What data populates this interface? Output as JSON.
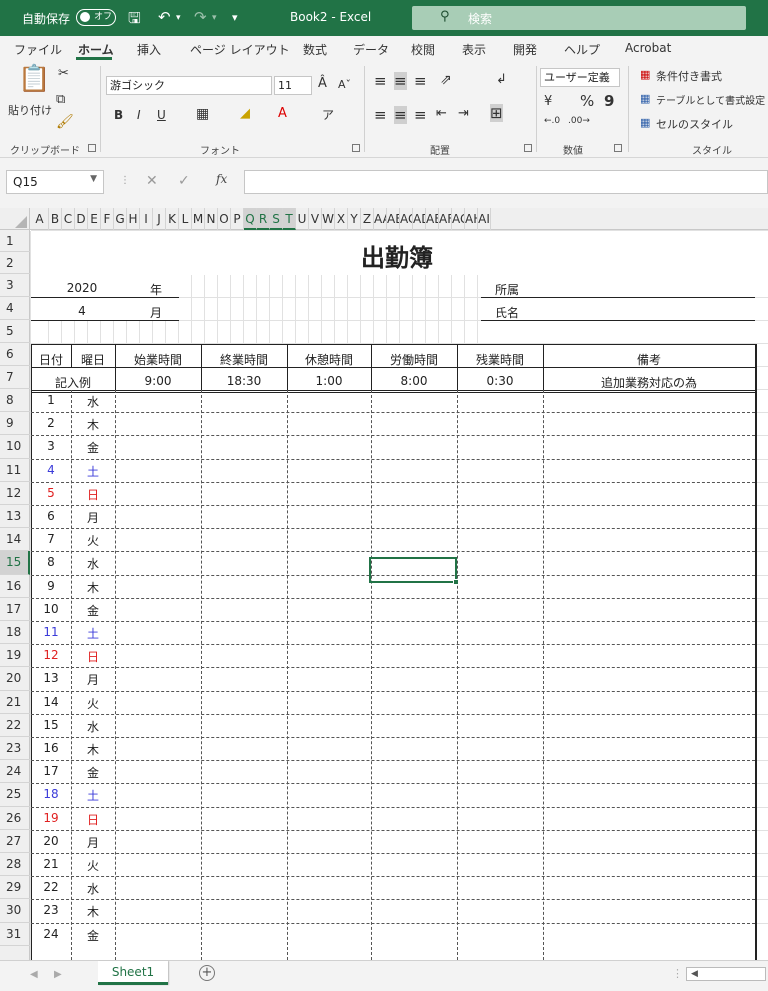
{
  "titlebar": {
    "autosave_label": "自動保存",
    "autosave_state": "オフ",
    "save_icon": "save-icon",
    "undo_icon": "undo-icon",
    "redo_icon": "redo-icon",
    "document_title": "Book2  -  Excel",
    "search_placeholder": "検索",
    "bg_color": "#217346"
  },
  "ribbon_tabs": [
    "ファイル",
    "ホーム",
    "挿入",
    "ページ レイアウト",
    "数式",
    "データ",
    "校閲",
    "表示",
    "開発",
    "ヘルプ",
    "Acrobat"
  ],
  "active_tab": "ホーム",
  "ribbon": {
    "clipboard": {
      "paste_label": "貼り付け",
      "group_label": "クリップボード"
    },
    "font": {
      "font_name": "游ゴシック",
      "font_size": "11",
      "bold": "B",
      "italic": "I",
      "underline": "U",
      "group_label": "フォント"
    },
    "alignment": {
      "group_label": "配置"
    },
    "number": {
      "format": "ユーザー定義",
      "percent": "%",
      "comma": "9",
      "group_label": "数値"
    },
    "styles": {
      "conditional": "条件付き書式",
      "format_table": "テーブルとして書式設定",
      "cell_styles": "セルのスタイル",
      "group_label": "スタイル"
    }
  },
  "formula_bar": {
    "name_box": "Q15",
    "fx": "fx",
    "formula": ""
  },
  "column_headers": [
    "A",
    "B",
    "C",
    "D",
    "E",
    "F",
    "G",
    "H",
    "I",
    "J",
    "K",
    "L",
    "M",
    "N",
    "O",
    "P",
    "Q",
    "R",
    "S",
    "T",
    "U",
    "V",
    "W",
    "X",
    "Y",
    "Z",
    "AA",
    "AB",
    "AC",
    "AD",
    "AE",
    "AF",
    "AG",
    "AH",
    "AI"
  ],
  "selected_columns": [
    "Q",
    "R",
    "S",
    "T"
  ],
  "row_headers": [
    "1",
    "2",
    "3",
    "4",
    "5",
    "6",
    "7",
    "8",
    "9",
    "10",
    "11",
    "12",
    "13",
    "14",
    "15",
    "16",
    "17",
    "18",
    "19",
    "20",
    "21",
    "22",
    "23",
    "24",
    "25",
    "26",
    "27",
    "28",
    "29",
    "30",
    "31"
  ],
  "selected_row": "15",
  "sheet": {
    "title": "出勤簿",
    "year_value": "2020",
    "year_label": "年",
    "month_value": "4",
    "month_label": "月",
    "dept_label": "所属",
    "name_label": "氏名",
    "headers": [
      "日付",
      "曜日",
      "始業時間",
      "終業時間",
      "休憩時間",
      "労働時間",
      "残業時間",
      "備考"
    ],
    "example": {
      "label": "記入例",
      "start": "9:00",
      "end": "18:30",
      "break": "1:00",
      "work": "8:00",
      "overtime": "0:30",
      "note": "追加業務対応の為"
    },
    "days": [
      {
        "date": "1",
        "dow": "水",
        "color": ""
      },
      {
        "date": "2",
        "dow": "木",
        "color": ""
      },
      {
        "date": "3",
        "dow": "金",
        "color": ""
      },
      {
        "date": "4",
        "dow": "土",
        "color": "blue"
      },
      {
        "date": "5",
        "dow": "日",
        "color": "red"
      },
      {
        "date": "6",
        "dow": "月",
        "color": ""
      },
      {
        "date": "7",
        "dow": "火",
        "color": ""
      },
      {
        "date": "8",
        "dow": "水",
        "color": ""
      },
      {
        "date": "9",
        "dow": "木",
        "color": ""
      },
      {
        "date": "10",
        "dow": "金",
        "color": ""
      },
      {
        "date": "11",
        "dow": "土",
        "color": "blue"
      },
      {
        "date": "12",
        "dow": "日",
        "color": "red"
      },
      {
        "date": "13",
        "dow": "月",
        "color": ""
      },
      {
        "date": "14",
        "dow": "火",
        "color": ""
      },
      {
        "date": "15",
        "dow": "水",
        "color": ""
      },
      {
        "date": "16",
        "dow": "木",
        "color": ""
      },
      {
        "date": "17",
        "dow": "金",
        "color": ""
      },
      {
        "date": "18",
        "dow": "土",
        "color": "blue"
      },
      {
        "date": "19",
        "dow": "日",
        "color": "red"
      },
      {
        "date": "20",
        "dow": "月",
        "color": ""
      },
      {
        "date": "21",
        "dow": "火",
        "color": ""
      },
      {
        "date": "22",
        "dow": "水",
        "color": ""
      },
      {
        "date": "23",
        "dow": "木",
        "color": ""
      },
      {
        "date": "24",
        "dow": "金",
        "color": ""
      }
    ],
    "colors": {
      "saturday": "#3b3bd9",
      "sunday": "#e02020",
      "selection": "#217346"
    }
  },
  "sheet_tabs": [
    "Sheet1"
  ],
  "active_sheet": "Sheet1"
}
